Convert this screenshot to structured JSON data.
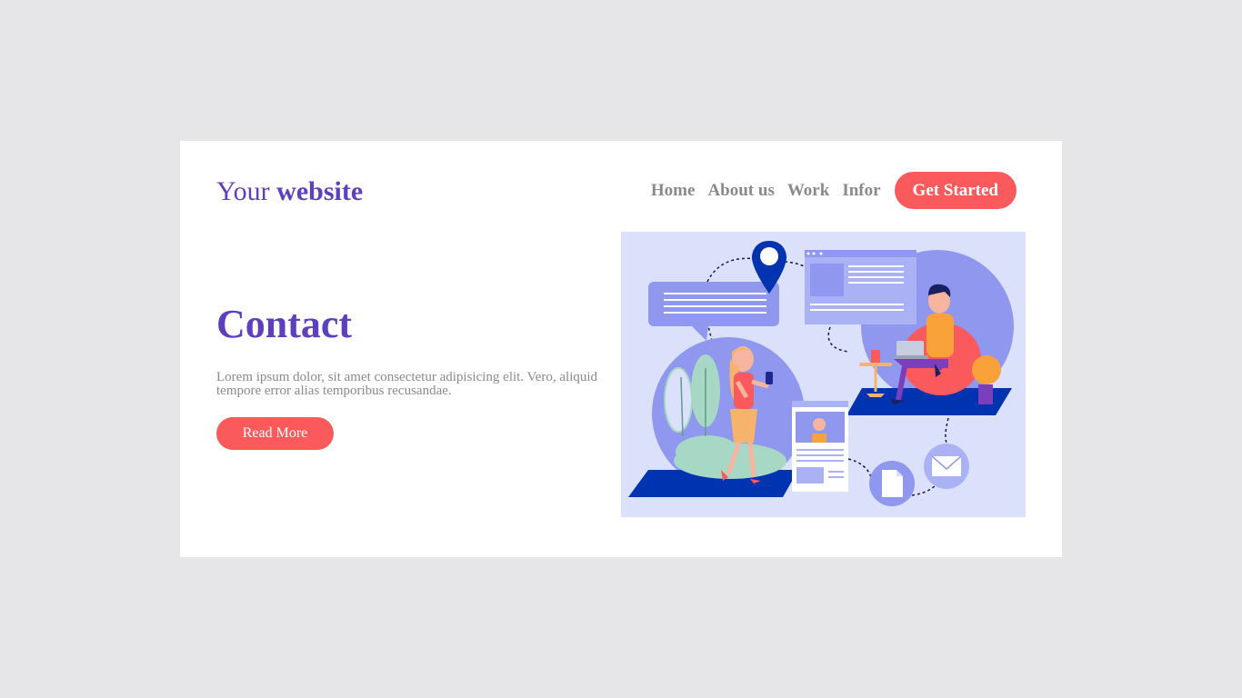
{
  "header": {
    "logo_light": "Your",
    "logo_bold": "website",
    "nav": [
      "Home",
      "About us",
      "Work",
      "Infor"
    ],
    "cta_label": "Get Started"
  },
  "hero": {
    "title": "Contact",
    "text": "Lorem ipsum dolor, sit amet consectetur adipisicing elit. Vero, aliquid tempore error alias temporibus recusandae.",
    "button_label": "Read More"
  },
  "colors": {
    "page_background": "#e6e6e8",
    "brand_purple": "#5e3fbe",
    "accent_coral": "#fb5a5d",
    "nav_gray": "#8a8a8a",
    "illustration_background": "#dbe1fb"
  },
  "illustration": {
    "icons": [
      "location-pin-icon",
      "chat-bubble-icon",
      "browser-window-icon",
      "profile-card-icon",
      "document-icon",
      "envelope-icon"
    ]
  }
}
